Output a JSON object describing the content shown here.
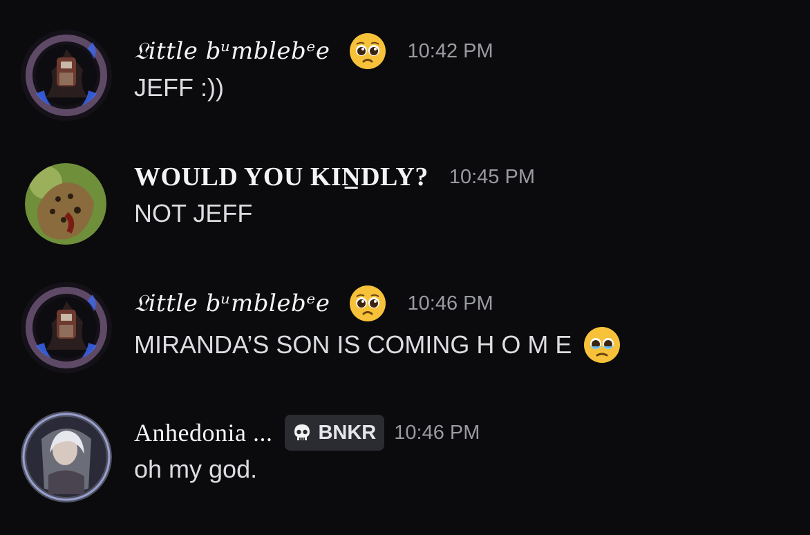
{
  "messages": [
    {
      "username": "𝔏ittle bᵘmblebᵉe",
      "emoji": "pleading-face",
      "timestamp": "10:42 PM",
      "text": "JEFF :))"
    },
    {
      "username": "WOULD YOU KIN̲DLY?",
      "timestamp": "10:45 PM",
      "text": "NOT JEFF"
    },
    {
      "username": "𝔏ittle bᵘmblebᵉe",
      "emoji": "pleading-face",
      "timestamp": "10:46 PM",
      "text": "MIRANDA’S SON IS COMING H O M E",
      "trailing_emoji": "holding-back-tears-face"
    },
    {
      "username": "Anhedonia ...",
      "tag": {
        "icon": "skull-icon",
        "label": "BNKR"
      },
      "timestamp": "10:46 PM",
      "text": "oh my god."
    }
  ],
  "colors": {
    "background": "#0b0b0d",
    "username": "#f2f3f5",
    "message_text": "#dcdde1",
    "timestamp": "#9a9ba1",
    "tag_background": "#2b2c31"
  }
}
